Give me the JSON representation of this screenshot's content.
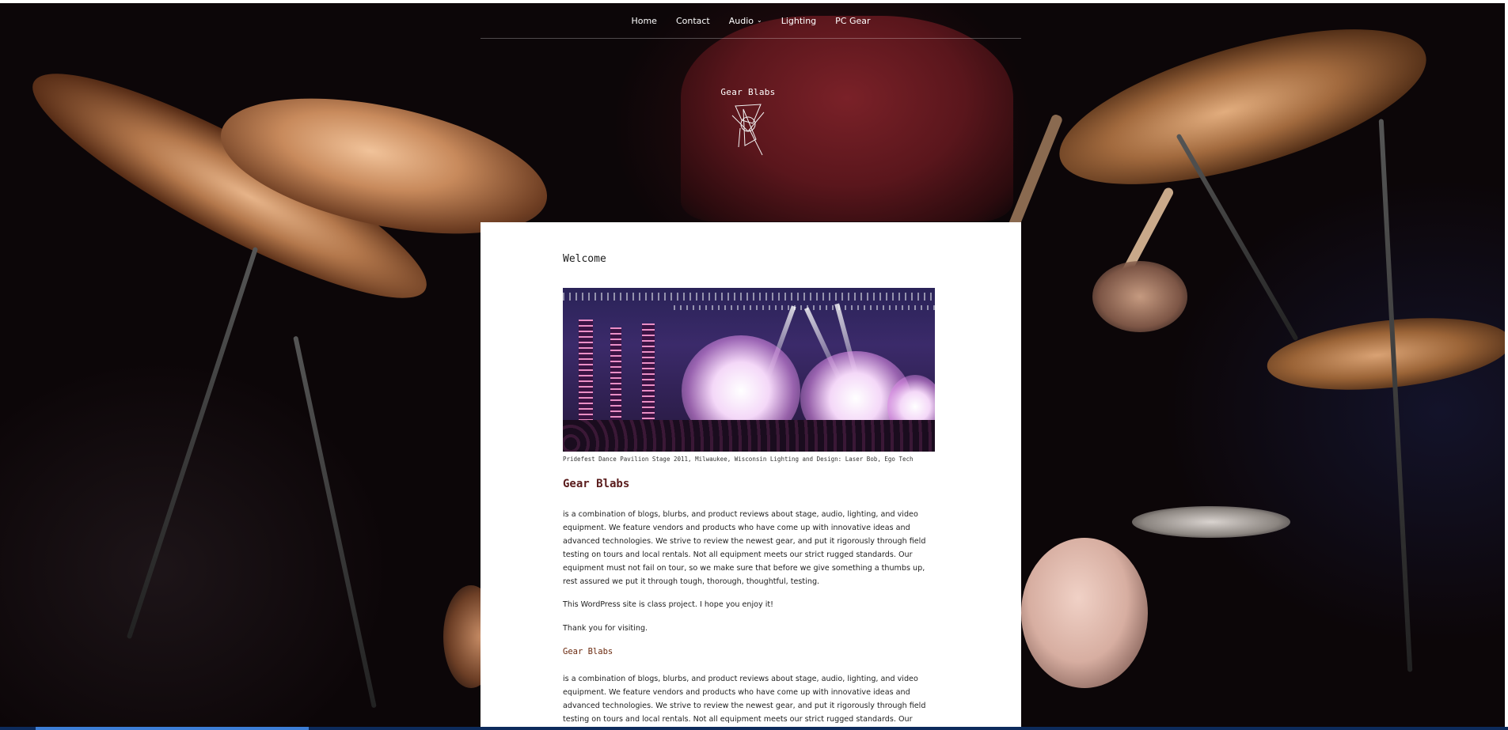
{
  "nav": {
    "items": [
      {
        "label": "Home"
      },
      {
        "label": "Contact"
      },
      {
        "label": "Audio",
        "has_dropdown": true
      },
      {
        "label": "Lighting"
      },
      {
        "label": "PC Gear"
      }
    ],
    "dropdown_icon": "chevron-down-icon",
    "dropdown_glyph": "⌄"
  },
  "site": {
    "title": "Gear Blabs",
    "logo_icon": "geometric-logo-icon"
  },
  "page": {
    "title": "Welcome",
    "hero_caption": "Pridefest Dance Pavilion Stage 2011, Milwaukee, Wisconsin Lighting and Design: Laser Bob, Ego Tech",
    "heading": "Gear Blabs",
    "paragraph1": "is a combination of blogs, blurbs, and product reviews about stage, audio, lighting, and video equipment. We feature vendors and products who have come up with innovative ideas and advanced technologies.  We strive to review the newest gear, and put it rigorously through field testing on tours and local rentals. Not all equipment meets our strict rugged standards.  Our equipment must not fail on tour, so we make sure that before we give something a thumbs up, rest assured we put it through tough, thorough, thoughtful, testing.",
    "paragraph2": "This WordPress site is class project. I hope you enjoy it!",
    "paragraph3": "Thank you for visiting.",
    "subheading": "Gear Blabs",
    "paragraph4": "is a combination of blogs, blurbs, and product reviews about stage, audio, lighting, and video equipment. We feature vendors and products who have come up with innovative ideas and advanced technologies. We strive to review the newest gear, and put it rigorously through field testing on tours and local rentals. Not all equipment meets our strict rugged standards. Our"
  },
  "colors": {
    "heading": "#5a1c1c",
    "subheading": "#6b2a0f",
    "card_bg": "#ffffff",
    "nav_text": "#ffffff"
  }
}
